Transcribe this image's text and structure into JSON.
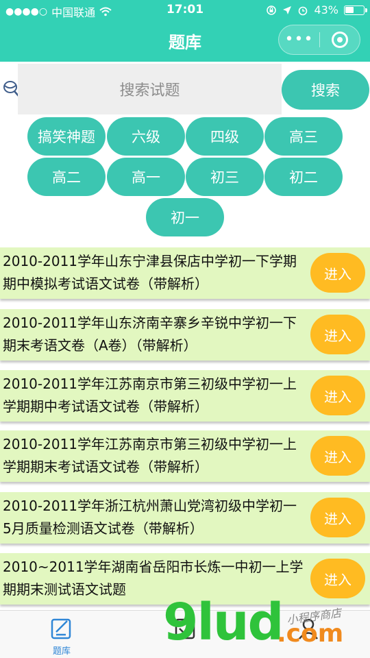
{
  "status_bar": {
    "carrier": "中国联通",
    "time": "17:01",
    "battery": "43%"
  },
  "nav": {
    "title": "题库",
    "more_label": "•••"
  },
  "search": {
    "placeholder": "搜索试题",
    "button_label": "搜索"
  },
  "tags": [
    "搞笑神题",
    "六级",
    "四级",
    "高三",
    "高二",
    "高一",
    "初三",
    "初二",
    "初一"
  ],
  "papers": [
    {
      "title": "2010-2011学年山东宁津县保店中学初一下学期期中模拟考试语文试卷（带解析）",
      "action": "进入"
    },
    {
      "title": "2010-2011学年山东济南辛寨乡辛锐中学初一下期末考语文卷（A卷）（带解析）",
      "action": "进入"
    },
    {
      "title": "2010-2011学年江苏南京市第三初级中学初一上学期期中考试语文试卷（带解析）",
      "action": "进入"
    },
    {
      "title": "2010-2011学年江苏南京市第三初级中学初一上学期期末考试语文试卷（带解析）",
      "action": "进入"
    },
    {
      "title": "2010-2011学年浙江杭州萧山党湾初级中学初一5月质量检测语文试卷（带解析）",
      "action": "进入"
    },
    {
      "title": "2010~2011学年湖南省岳阳市长炼一中初一上学期期末测试语文试题",
      "action": "进入"
    }
  ],
  "tab_bar": {
    "items": [
      {
        "label": "题库",
        "icon": "edit-note-icon",
        "active": true
      },
      {
        "label": "",
        "icon": "checklist-icon",
        "active": false
      },
      {
        "label": "",
        "icon": "user-icon",
        "active": false
      }
    ]
  },
  "watermark": {
    "brand": "9lud",
    "domain": ".com",
    "tag": "小程序商店"
  },
  "colors": {
    "header": "#33d1b5",
    "tag_button": "#3cc6b1",
    "card_bg": "#e2f7c0",
    "enter_button": "#ffbb22"
  }
}
